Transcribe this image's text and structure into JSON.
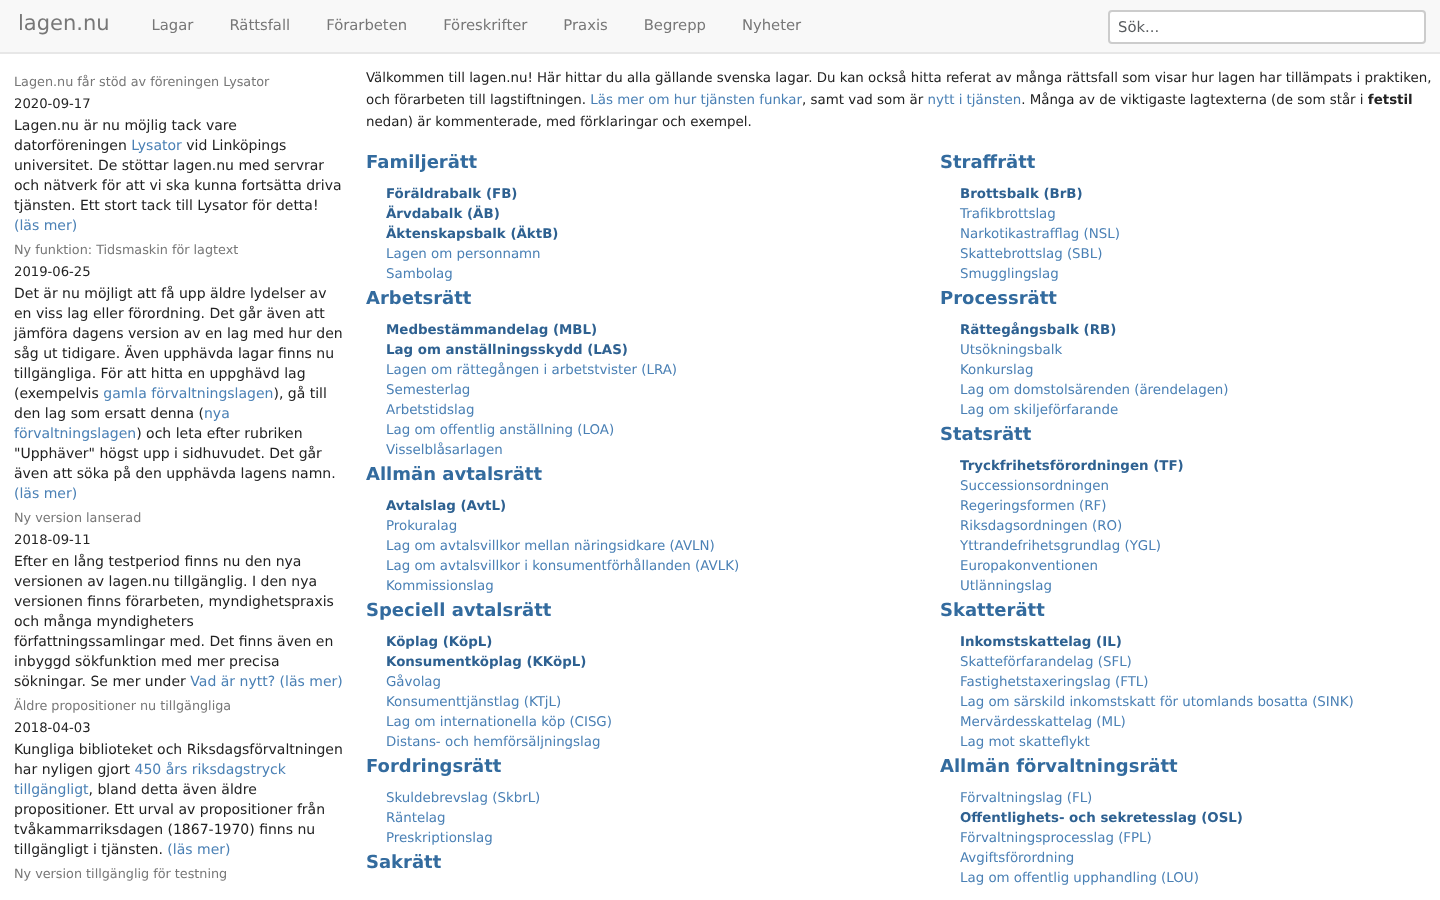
{
  "navbar": {
    "brand": "lagen.nu",
    "items": [
      {
        "label": "Lagar"
      },
      {
        "label": "Rättsfall"
      },
      {
        "label": "Förarbeten"
      },
      {
        "label": "Föreskrifter"
      },
      {
        "label": "Praxis"
      },
      {
        "label": "Begrepp"
      },
      {
        "label": "Nyheter"
      }
    ],
    "search": {
      "placeholder": "Sök..."
    }
  },
  "sidebar": {
    "news": [
      {
        "title": "Lagen.nu får stöd av föreningen Lysator",
        "date": "2020-09-17",
        "parts": [
          {
            "kind": "text",
            "text": "Lagen.nu är nu möjlig tack vare datorföreningen "
          },
          {
            "kind": "link",
            "text": "Lysator"
          },
          {
            "kind": "text",
            "text": " vid Linköpings universitet. De stöttar lagen.nu med servrar och nätverk för att vi ska kunna fortsätta driva tjänsten. Ett stort tack till Lysator för detta! "
          },
          {
            "kind": "link",
            "text": "(läs mer)"
          }
        ]
      },
      {
        "title": "Ny funktion: Tidsmaskin för lagtext",
        "date": "2019-06-25",
        "parts": [
          {
            "kind": "text",
            "text": "Det är nu möjligt att få upp äldre lydelser av en viss lag eller förordning. Det går även att jämföra dagens version av en lag med hur den såg ut tidigare. Även upphävda lagar finns nu tillgängliga. För att hitta en uppghävd lag (exempelvis "
          },
          {
            "kind": "link",
            "text": "gamla förvaltningslagen"
          },
          {
            "kind": "text",
            "text": "), gå till den lag som ersatt denna ("
          },
          {
            "kind": "link",
            "text": "nya"
          },
          {
            "kind": "link",
            "text": "förvaltningslagen"
          },
          {
            "kind": "text",
            "text": ") och leta efter rubriken \"Upphäver\" högst upp i sidhuvudet. Det går även att söka på den upphävda lagens namn. "
          },
          {
            "kind": "link",
            "text": "(läs mer)"
          }
        ]
      },
      {
        "title": "Ny version lanserad",
        "date": "2018-09-11",
        "parts": [
          {
            "kind": "text",
            "text": "Efter en lång testperiod finns nu den nya versionen av lagen.nu tillgänglig. I den nya versionen finns förarbeten, myndighetspraxis och många myndigheters författningssamlingar med. Det finns även en inbyggd sökfunktion med mer precisa sökningar. Se mer under "
          },
          {
            "kind": "link",
            "text": "Vad är nytt?"
          },
          {
            "kind": "link",
            "text": "(läs mer)"
          }
        ]
      },
      {
        "title": "Äldre propositioner nu tillgängliga",
        "date": "2018-04-03",
        "parts": [
          {
            "kind": "text",
            "text": "Kungliga biblioteket och Riksdagsförvaltningen har nyligen gjort "
          },
          {
            "kind": "link",
            "text": "450 års riksdagstryck"
          },
          {
            "kind": "link",
            "text": "tillgängligt"
          },
          {
            "kind": "text",
            "text": ", bland detta även äldre propositioner. Ett urval av propositioner från tvåkammarriksdagen (1867-1970) finns nu tillgängligt i tjänsten. "
          },
          {
            "kind": "link",
            "text": "(läs mer)"
          }
        ]
      },
      {
        "title": "Ny version tillgänglig för testning"
      }
    ]
  },
  "main": {
    "intro": [
      {
        "kind": "text",
        "text": "Välkommen till lagen.nu! Här hittar du alla gällande svenska lagar. Du kan också hitta referat av många rättsfall som visar hur lagen har tillämpats i praktiken, och förarbeten till lagstiftningen. "
      },
      {
        "kind": "link",
        "text": "Läs mer om hur tjänsten funkar"
      },
      {
        "kind": "text",
        "text": ", samt vad som är "
      },
      {
        "kind": "link",
        "text": "nytt i tjänsten"
      },
      {
        "kind": "text",
        "text": ". Många av de viktigaste lagtexterna (de som står i **fetstil** nedan) är kommenterade, med förklaringar och exempel."
      }
    ],
    "columns": [
      {
        "sections": [
          {
            "heading": "Familjerätt",
            "items": [
              {
                "label": "Föräldrabalk (FB)",
                "bold": true
              },
              {
                "label": "Ärvdabalk (ÄB)",
                "bold": true
              },
              {
                "label": "Äktenskapsbalk (ÄktB)",
                "bold": true
              },
              {
                "label": "Lagen om personnamn",
                "bold": false
              },
              {
                "label": "Sambolag",
                "bold": false
              }
            ]
          },
          {
            "heading": "Arbetsrätt",
            "items": [
              {
                "label": "Medbestämmandelag (MBL)",
                "bold": true
              },
              {
                "label": "Lag om anställningsskydd (LAS)",
                "bold": true
              },
              {
                "label": "Lagen om rättegången i arbetstvister (LRA)",
                "bold": false
              },
              {
                "label": "Semesterlag",
                "bold": false
              },
              {
                "label": "Arbetstidslag",
                "bold": false
              },
              {
                "label": "Lag om offentlig anställning (LOA)",
                "bold": false
              },
              {
                "label": "Visselblåsarlagen",
                "bold": false
              }
            ]
          },
          {
            "heading": "Allmän avtalsrätt",
            "items": [
              {
                "label": "Avtalslag (AvtL)",
                "bold": true
              },
              {
                "label": "Prokuralag",
                "bold": false
              },
              {
                "label": "Lag om avtalsvillkor mellan näringsidkare (AVLN)",
                "bold": false
              },
              {
                "label": "Lag om avtalsvillkor i konsumentförhållanden (AVLK)",
                "bold": false
              },
              {
                "label": "Kommissionslag",
                "bold": false
              }
            ]
          },
          {
            "heading": "Speciell avtalsrätt",
            "items": [
              {
                "label": "Köplag (KöpL)",
                "bold": true
              },
              {
                "label": "Konsumentköplag (KKöpL)",
                "bold": true
              },
              {
                "label": "Gåvolag",
                "bold": false
              },
              {
                "label": "Konsumenttjänstlag (KTjL)",
                "bold": false
              },
              {
                "label": "Lag om internationella köp (CISG)",
                "bold": false
              },
              {
                "label": "Distans- och hemförsäljningslag",
                "bold": false
              }
            ]
          },
          {
            "heading": "Fordringsrätt",
            "items": [
              {
                "label": "Skuldebrevslag (SkbrL)",
                "bold": false
              },
              {
                "label": "Räntelag",
                "bold": false
              },
              {
                "label": "Preskriptionslag",
                "bold": false
              }
            ]
          },
          {
            "heading": "Sakrätt"
          }
        ]
      },
      {
        "sections": [
          {
            "heading": "Straffrätt",
            "items": [
              {
                "label": "Brottsbalk (BrB)",
                "bold": true
              },
              {
                "label": "Trafikbrottslag",
                "bold": false
              },
              {
                "label": "Narkotikastrafflag (NSL)",
                "bold": false
              },
              {
                "label": "Skattebrottslag (SBL)",
                "bold": false
              },
              {
                "label": "Smugglingslag",
                "bold": false
              }
            ]
          },
          {
            "heading": "Processrätt",
            "items": [
              {
                "label": "Rättegångsbalk (RB)",
                "bold": true
              },
              {
                "label": "Utsökningsbalk",
                "bold": false
              },
              {
                "label": "Konkurslag",
                "bold": false
              },
              {
                "label": "Lag om domstolsärenden (ärendelagen)",
                "bold": false
              },
              {
                "label": "Lag om skiljeförfarande",
                "bold": false
              }
            ]
          },
          {
            "heading": "Statsrätt",
            "items": [
              {
                "label": "Tryckfrihetsförordningen (TF)",
                "bold": true
              },
              {
                "label": "Successionsordningen",
                "bold": false
              },
              {
                "label": "Regeringsformen (RF)",
                "bold": false
              },
              {
                "label": "Riksdagsordningen (RO)",
                "bold": false
              },
              {
                "label": "Yttrandefrihetsgrundlag (YGL)",
                "bold": false
              },
              {
                "label": "Europakonventionen",
                "bold": false
              },
              {
                "label": "Utlänningslag",
                "bold": false
              }
            ]
          },
          {
            "heading": "Skatterätt",
            "items": [
              {
                "label": "Inkomstskattelag (IL)",
                "bold": true
              },
              {
                "label": "Skatteförfarandelag (SFL)",
                "bold": false
              },
              {
                "label": "Fastighetstaxeringslag (FTL)",
                "bold": false
              },
              {
                "label": "Lag om särskild inkomstskatt för utomlands bosatta (SINK)",
                "bold": false
              },
              {
                "label": "Mervärdesskattelag (ML)",
                "bold": false
              },
              {
                "label": "Lag mot skatteflykt",
                "bold": false
              }
            ]
          },
          {
            "heading": "Allmän förvaltningsrätt",
            "items": [
              {
                "label": "Förvaltningslag (FL)",
                "bold": false
              },
              {
                "label": "Offentlighets- och sekretesslag (OSL)",
                "bold": true
              },
              {
                "label": "Förvaltningsprocesslag (FPL)",
                "bold": false
              },
              {
                "label": "Avgiftsförordning",
                "bold": false
              },
              {
                "label": "Lag om offentlig upphandling (LOU)",
                "bold": false
              }
            ]
          }
        ]
      }
    ]
  }
}
